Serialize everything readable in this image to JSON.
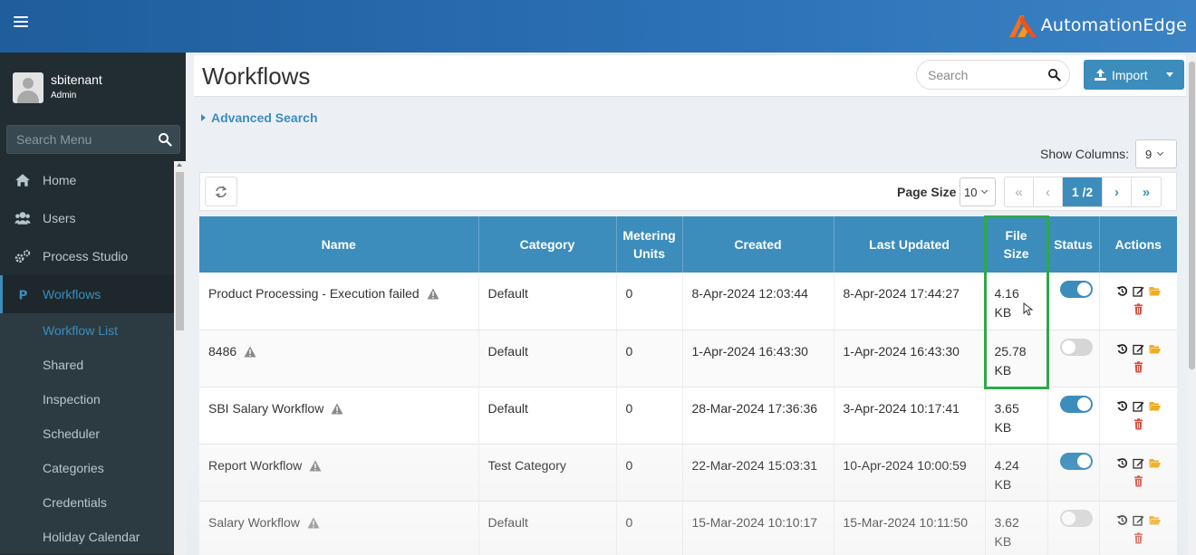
{
  "app": {
    "brand": "AutomationEdge"
  },
  "user": {
    "name": "sbitenant",
    "role": "Admin"
  },
  "sidebar": {
    "search_placeholder": "Search Menu",
    "items": [
      {
        "label": "Home",
        "icon": "home-icon"
      },
      {
        "label": "Users",
        "icon": "users-icon"
      },
      {
        "label": "Process Studio",
        "icon": "cogs-icon"
      },
      {
        "label": "Workflows",
        "icon": "workflow-icon",
        "active": true
      }
    ],
    "subitems": [
      {
        "label": "Workflow List",
        "active": true
      },
      {
        "label": "Shared"
      },
      {
        "label": "Inspection"
      },
      {
        "label": "Scheduler"
      },
      {
        "label": "Categories"
      },
      {
        "label": "Credentials"
      },
      {
        "label": "Holiday Calendar"
      }
    ]
  },
  "header": {
    "title": "Workflows",
    "search_placeholder": "Search",
    "import_label": "Import"
  },
  "advanced_search": "Advanced Search",
  "show_columns": {
    "label": "Show Columns:",
    "value": "9"
  },
  "toolbar": {
    "page_size_label": "Page Size",
    "page_size": "10",
    "page_indicator": "1 /2"
  },
  "table": {
    "columns": [
      "Name",
      "Category",
      "Metering Units",
      "Created",
      "Last Updated",
      "File Size",
      "Status",
      "Actions"
    ],
    "rows": [
      {
        "name": "Product Processing - Execution failed",
        "category": "Default",
        "units": "0",
        "created": "8-Apr-2024 12:03:44",
        "updated": "8-Apr-2024 17:44:27",
        "size": "4.16 KB",
        "status_on": true
      },
      {
        "name": "8486",
        "category": "Default",
        "units": "0",
        "created": "1-Apr-2024 16:43:30",
        "updated": "1-Apr-2024 16:43:30",
        "size": "25.78 KB",
        "status_on": false
      },
      {
        "name": "SBI Salary Workflow",
        "category": "Default",
        "units": "0",
        "created": "28-Mar-2024 17:36:36",
        "updated": "3-Apr-2024 10:17:41",
        "size": "3.65 KB",
        "status_on": true
      },
      {
        "name": "Report Workflow",
        "category": "Test Category",
        "units": "0",
        "created": "22-Mar-2024 15:03:31",
        "updated": "10-Apr-2024 10:00:59",
        "size": "4.24 KB",
        "status_on": true
      },
      {
        "name": "Salary Workflow",
        "category": "Default",
        "units": "0",
        "created": "15-Mar-2024 10:10:17",
        "updated": "15-Mar-2024 10:11:50",
        "size": "3.62 KB",
        "status_on": false
      }
    ]
  },
  "colors": {
    "primary": "#3c8dbc",
    "sidebar_bg": "#222d32",
    "highlight": "#2ea84a",
    "delete": "#dd4b39",
    "folder": "#f0ad1e"
  }
}
